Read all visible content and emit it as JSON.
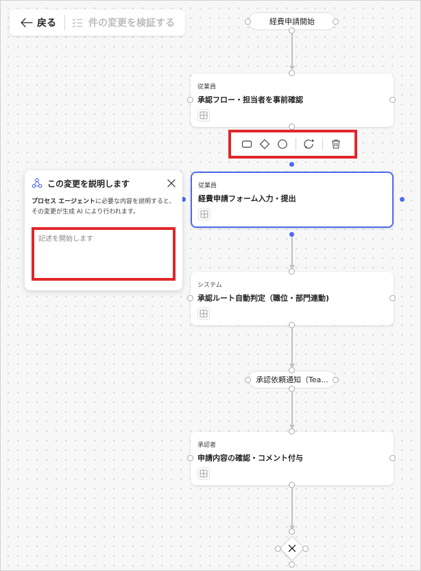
{
  "toolbar": {
    "back_label": "戻る",
    "validate_label": "件の変更を検証する"
  },
  "flow": {
    "start_label": "経費申請開始",
    "steps": [
      {
        "role": "従業員",
        "title": "承認フロー・担当者を事前確認"
      },
      {
        "role": "従業員",
        "title": "経費申請フォーム入力・提出"
      },
      {
        "role": "システム",
        "title": "承認ルート自動判定（職位・部門連動)"
      },
      {
        "role": "承認者",
        "title": "申請内容の確認・コメント付与"
      }
    ],
    "notify_label": "承認依頼通知（Tea..."
  },
  "panel": {
    "title": "この変更を説明します",
    "desc_bold": "プロセス エージェント",
    "desc_rest": "に必要な内容を説明すると、その変更が生成 AI により行われます。",
    "input_placeholder": "記述を開始します",
    "input_value": ""
  },
  "colors": {
    "accent": "#4f6bed",
    "highlight": "#e0262b",
    "connector": "#bfbfbf"
  }
}
